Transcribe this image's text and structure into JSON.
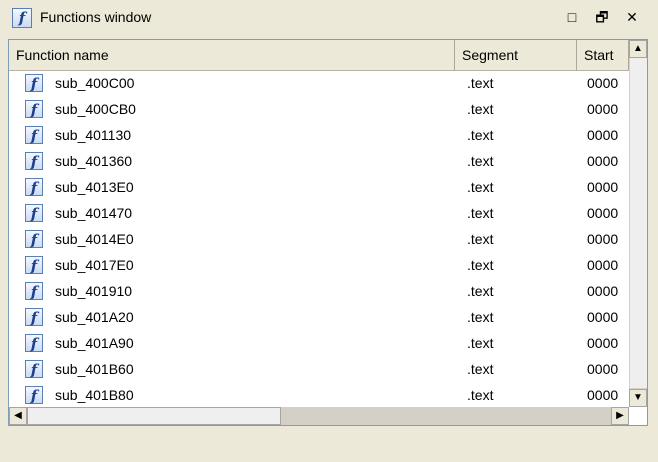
{
  "window": {
    "title": "Functions window",
    "icon": "function-icon",
    "controls": [
      "maximize-icon",
      "restore-icon",
      "close-icon"
    ]
  },
  "table": {
    "columns": [
      "Function name",
      "Segment",
      "Start"
    ],
    "rows": [
      {
        "name": "sub_400C00",
        "segment": ".text",
        "start": "0000"
      },
      {
        "name": "sub_400CB0",
        "segment": ".text",
        "start": "0000"
      },
      {
        "name": "sub_401130",
        "segment": ".text",
        "start": "0000"
      },
      {
        "name": "sub_401360",
        "segment": ".text",
        "start": "0000"
      },
      {
        "name": "sub_4013E0",
        "segment": ".text",
        "start": "0000"
      },
      {
        "name": "sub_401470",
        "segment": ".text",
        "start": "0000"
      },
      {
        "name": "sub_4014E0",
        "segment": ".text",
        "start": "0000"
      },
      {
        "name": "sub_4017E0",
        "segment": ".text",
        "start": "0000"
      },
      {
        "name": "sub_401910",
        "segment": ".text",
        "start": "0000"
      },
      {
        "name": "sub_401A20",
        "segment": ".text",
        "start": "0000"
      },
      {
        "name": "sub_401A90",
        "segment": ".text",
        "start": "0000"
      },
      {
        "name": "sub_401B60",
        "segment": ".text",
        "start": "0000"
      },
      {
        "name": "sub_401B80",
        "segment": ".text",
        "start": "0000"
      }
    ]
  }
}
